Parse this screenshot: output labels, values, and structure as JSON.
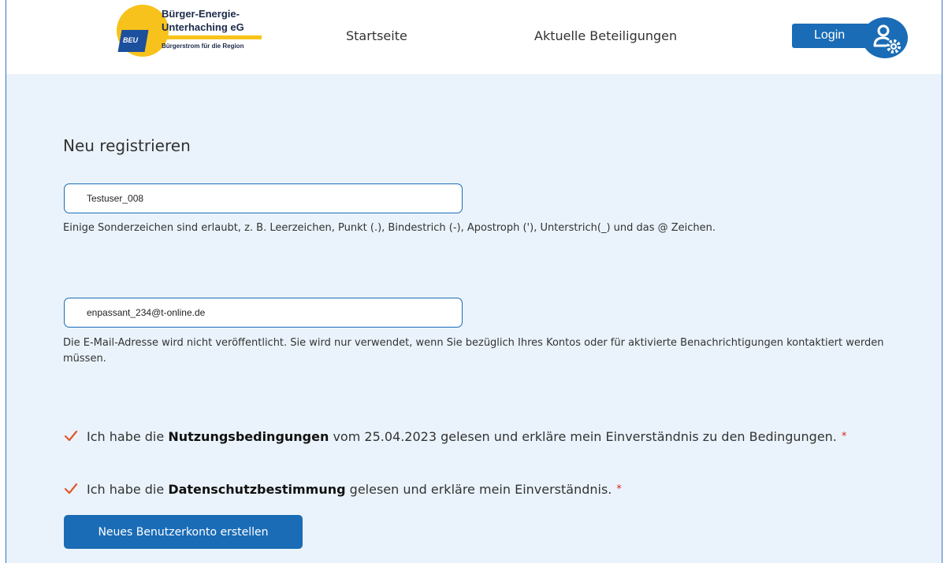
{
  "header": {
    "logo": {
      "badge": "BEU",
      "line1": "Bürger-Energie-",
      "line2": "Unterhaching eG",
      "tagline": "Bürgerstrom für die Region"
    },
    "nav": {
      "home": "Startseite",
      "projects": "Aktuelle Beteiligungen"
    },
    "login_label": "Login"
  },
  "form": {
    "title": "Neu registrieren",
    "username": {
      "value": "Testuser_008",
      "help": "Einige Sonderzeichen sind erlaubt, z. B. Leerzeichen, Punkt (.), Bindestrich (-), Apostroph ('), Unterstrich(_) und das @ Zeichen."
    },
    "email": {
      "value": "enpassant_234@t-online.de",
      "help": "Die E-Mail-Adresse wird nicht veröffentlicht. Sie wird nur verwendet, wenn Sie bezüglich Ihres Kontos oder für aktivierte Benachrichtigungen kontaktiert werden müssen."
    },
    "terms": {
      "before": "Ich habe die ",
      "link": "Nutzungsbedingungen",
      "after": " vom 25.04.2023 gelesen und erkläre mein Einverständnis zu den Bedingungen.",
      "required": "*"
    },
    "privacy": {
      "before": "Ich habe die ",
      "link": "Datenschutzbestimmung",
      "after": " gelesen und erkläre mein Einverständnis.",
      "required": "*"
    },
    "submit_label": "Neues Benutzerkonto erstellen"
  },
  "colors": {
    "accent": "#1a6cb6",
    "page_background": "#eaf3fb",
    "logo_yellow": "#f7c21b",
    "checkmark": "#e0562b",
    "required": "#d9261c"
  },
  "icons": {
    "checkmark": "checkmark-icon",
    "account": "user-settings-icon"
  }
}
